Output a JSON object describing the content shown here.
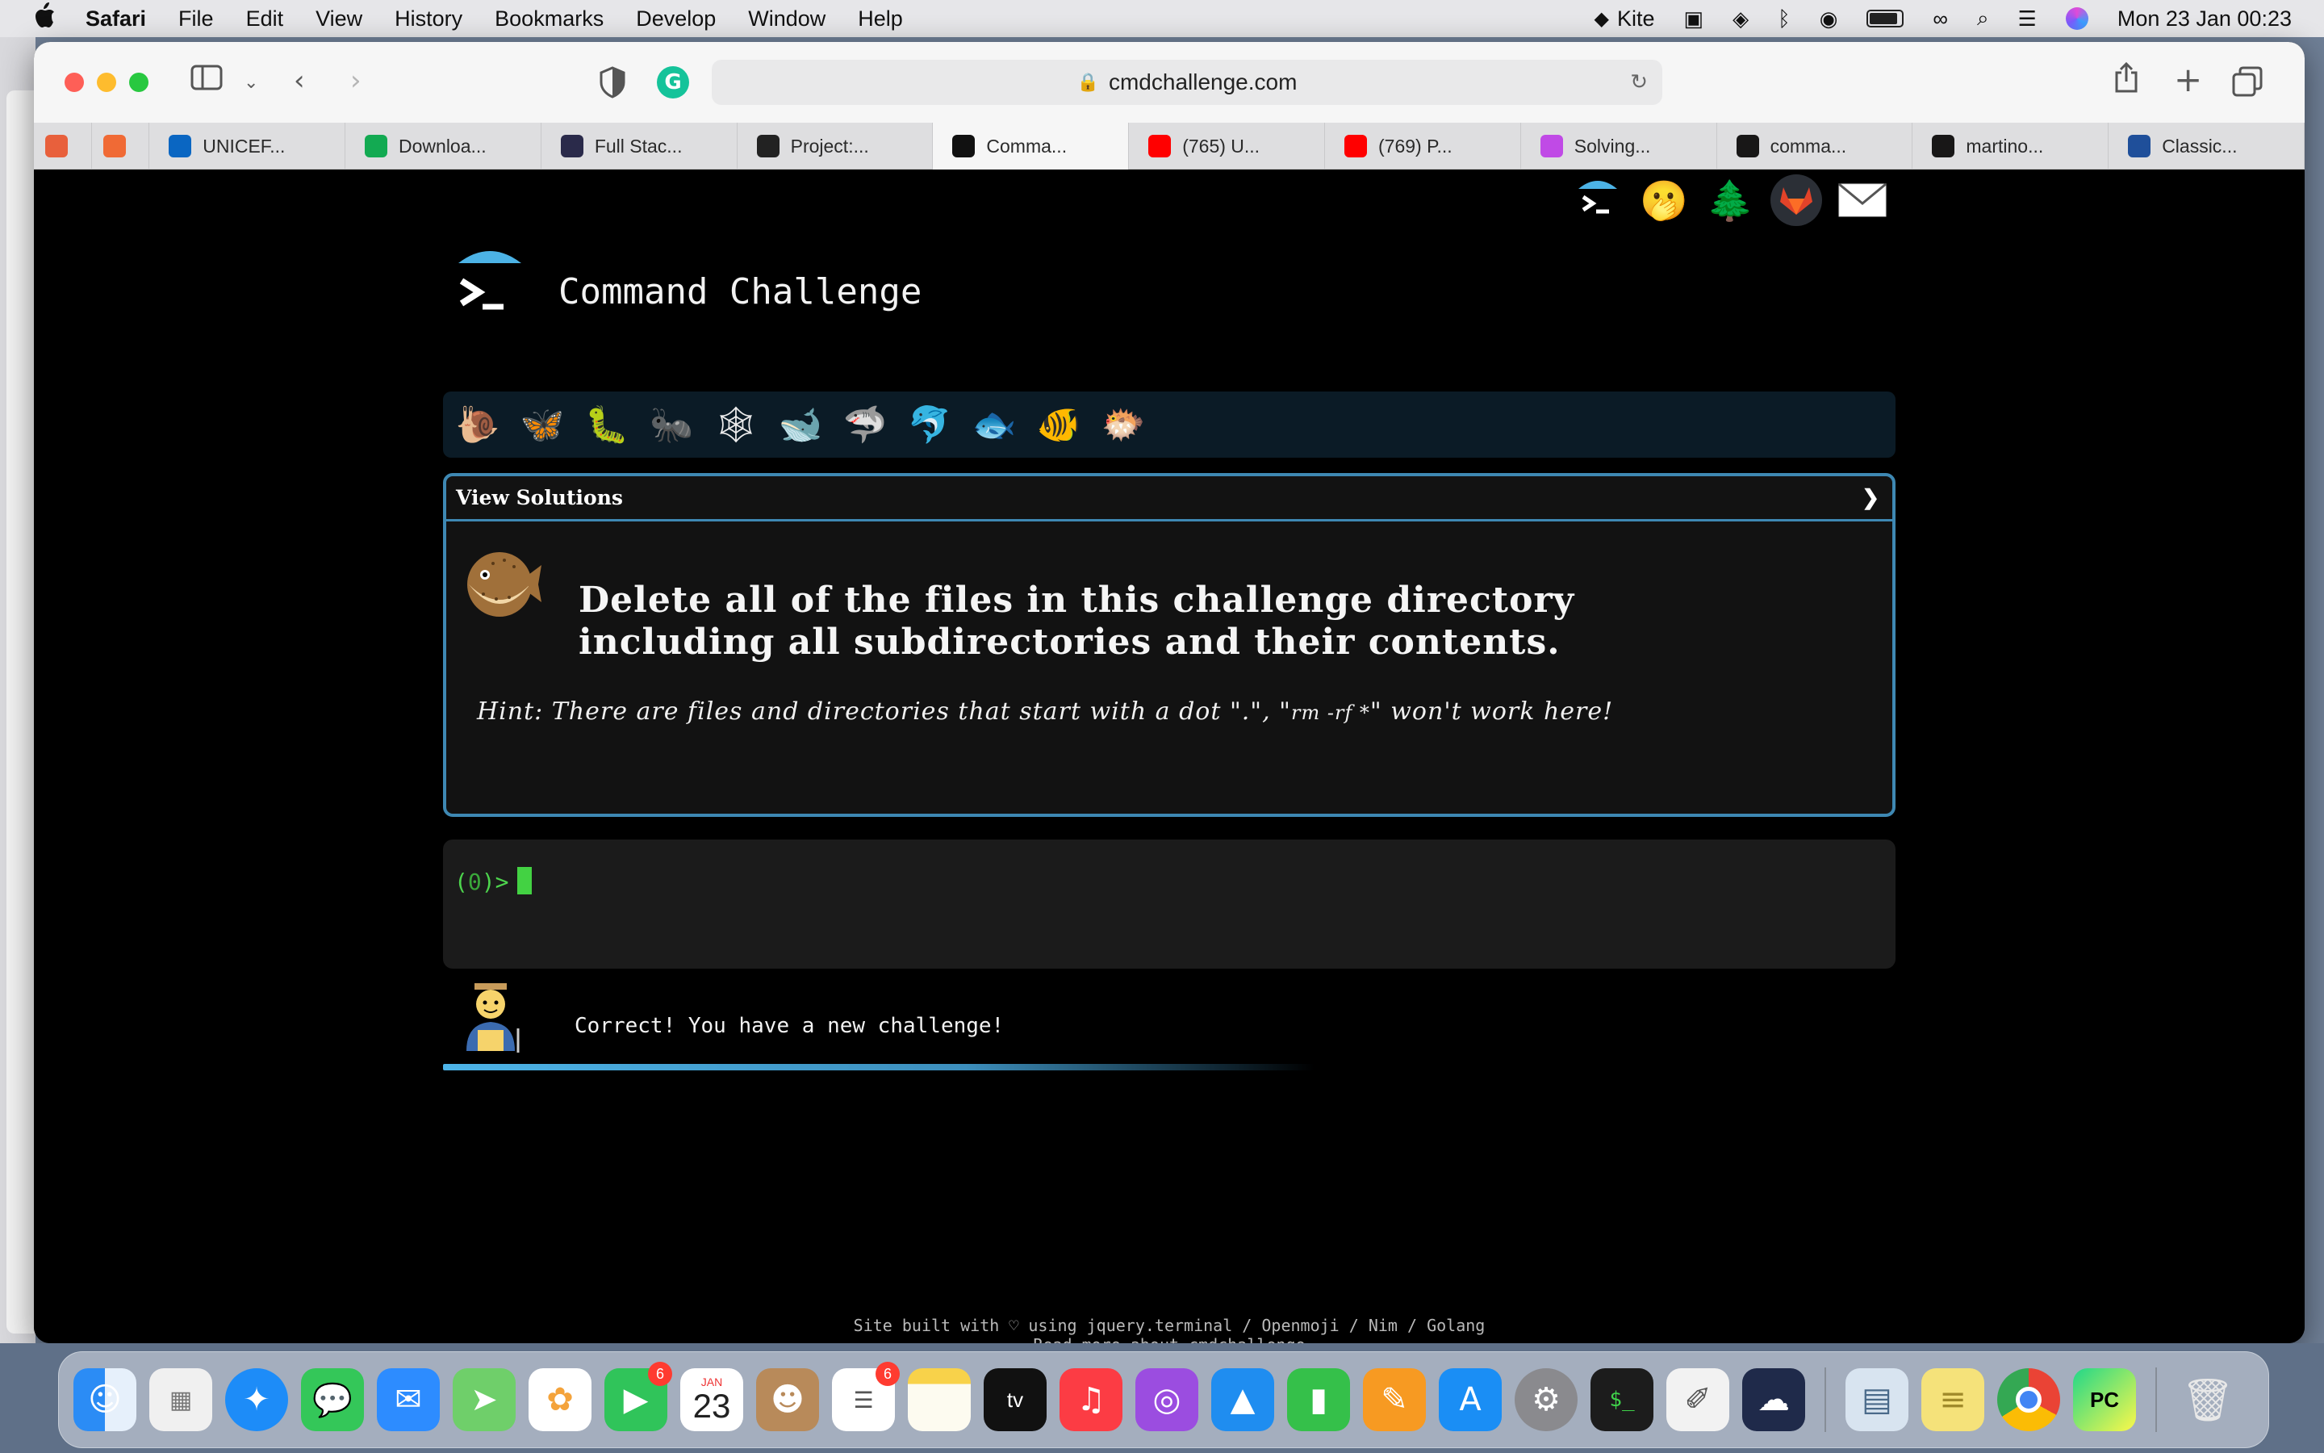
{
  "menubar": {
    "app_name": "Safari",
    "items": [
      "File",
      "Edit",
      "View",
      "History",
      "Bookmarks",
      "Develop",
      "Window",
      "Help"
    ],
    "kite_label": "Kite",
    "clock": "Mon 23 Jan  00:23"
  },
  "browser": {
    "url": "cmdchallenge.com",
    "tabs": [
      {
        "label": "",
        "icon": "pinned-tab-1",
        "color": "#e8603c"
      },
      {
        "label": "",
        "icon": "pinned-tab-2",
        "color": "#f06a35"
      },
      {
        "label": "UNICEF...",
        "icon": "linkedin-icon",
        "color": "#0a66c2"
      },
      {
        "label": "Downloa...",
        "icon": "mongodb-icon",
        "color": "#13aa52"
      },
      {
        "label": "Full Stac...",
        "icon": "fullstack-icon",
        "color": "#2a2a4a"
      },
      {
        "label": "Project:...",
        "icon": "alx-icon",
        "color": "#222222"
      },
      {
        "label": "Comma...",
        "icon": "terminal-icon",
        "color": "#111111"
      },
      {
        "label": "(765) U...",
        "icon": "youtube-icon",
        "color": "#ff0000"
      },
      {
        "label": "(769) P...",
        "icon": "youtube-icon",
        "color": "#ff0000"
      },
      {
        "label": "Solving...",
        "icon": "solving-icon",
        "color": "#c04ae6"
      },
      {
        "label": "comma...",
        "icon": "github-icon",
        "color": "#181717"
      },
      {
        "label": "martino...",
        "icon": "github-icon",
        "color": "#181717"
      },
      {
        "label": "Classic...",
        "icon": "classic-icon",
        "color": "#1f4f9a"
      }
    ],
    "active_tab_index": 6
  },
  "page": {
    "title": "Command Challenge",
    "view_solutions": "View Solutions",
    "chevron": "❯",
    "task_line1": "Delete all of the files in this challenge directory",
    "task_line2": "including all subdirectories and their contents.",
    "hint_prefix": "Hint: There are files and directories that start with a dot \".\", \"",
    "hint_code": "rm -rf *",
    "hint_suffix": "\" won't work here!",
    "prompt": "(0)>",
    "prompt_open": "(",
    "prompt_num": "0",
    "prompt_close": ")>",
    "result_message": "Correct! You have a new challenge!",
    "footer_line1": "Site built with ♡ using jquery.terminal / Openmoji / Nim / Golang",
    "footer_line2": "Read more about cmdchallenge"
  },
  "levels": [
    {
      "icon": "snail-icon",
      "glyph": "🐌"
    },
    {
      "icon": "butterfly-icon",
      "glyph": "🦋"
    },
    {
      "icon": "caterpillar-icon",
      "glyph": "🐛"
    },
    {
      "icon": "ant-icon",
      "glyph": "🐜"
    },
    {
      "icon": "spider-web-icon",
      "glyph": "🕸"
    },
    {
      "icon": "whale-icon",
      "glyph": "🐋"
    },
    {
      "icon": "shark-icon",
      "glyph": "🦈"
    },
    {
      "icon": "dolphin-icon",
      "glyph": "🐬"
    },
    {
      "icon": "fish-icon",
      "glyph": "🐟"
    },
    {
      "icon": "tropical-fish-icon",
      "glyph": "🐠"
    },
    {
      "icon": "blowfish-icon",
      "glyph": "🐡"
    }
  ],
  "dock": {
    "facetime_badge": "6",
    "reminders_badge": "6",
    "calendar_month": "JAN",
    "calendar_day": "23",
    "appletv_label": "tv"
  },
  "colors": {
    "accent_border": "#3e88b3",
    "prompt_green": "#4dd44d",
    "page_bg": "#000000"
  }
}
